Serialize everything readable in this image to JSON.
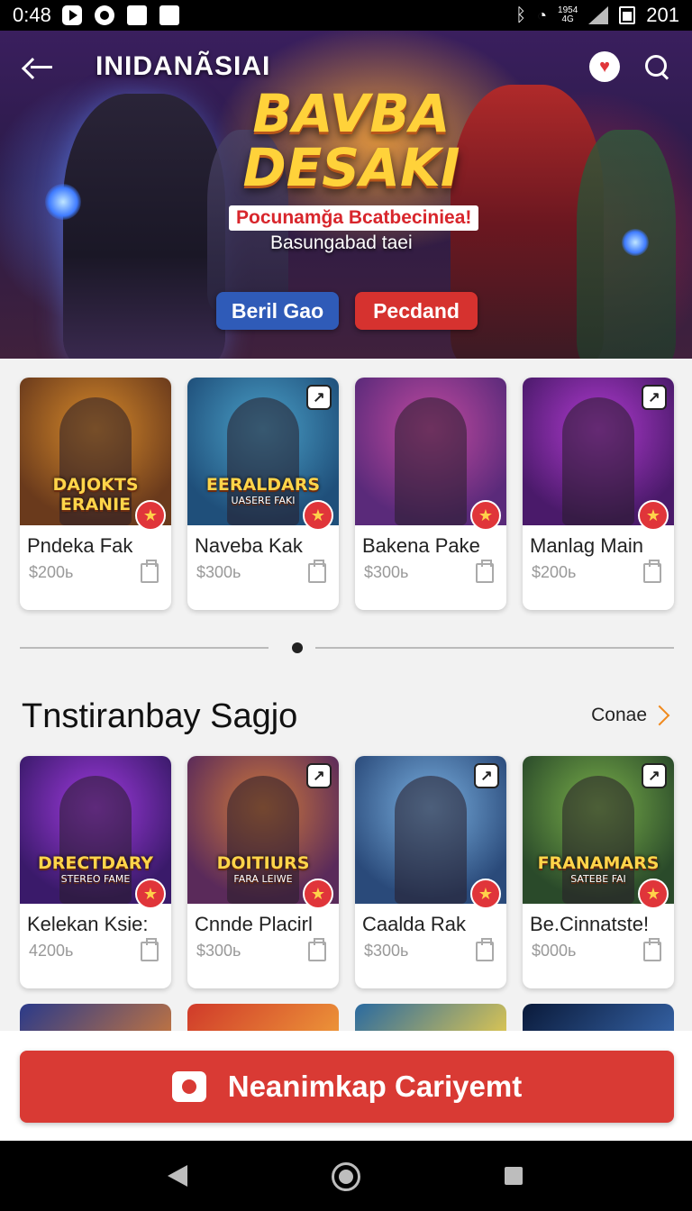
{
  "status_bar": {
    "time": "0:48",
    "signal_text_top": "1954",
    "signal_text_bottom": "4G",
    "battery": "201"
  },
  "header": {
    "title": "INIDANÃSIAI"
  },
  "hero": {
    "title_line1": "BAVBA",
    "title_line2": "DESAKI",
    "subtitle": "Pocunamğa Bcatbeciniea!",
    "subtitle2": "Basungabad taei",
    "button_primary": "Beril Gao",
    "button_secondary": "Pecdand"
  },
  "row1": [
    {
      "title": "Pndeka Fak",
      "price": "$200ь",
      "caption": "DAJOKTS ERANIE",
      "caption_small": "",
      "theme": [
        "#6a3a1c",
        "#d78a2a"
      ],
      "has_expand": false
    },
    {
      "title": "Naveba Kak",
      "price": "$300ь",
      "caption": "EERALDARS",
      "caption_small": "UASERE FAKI",
      "theme": [
        "#1f4f7a",
        "#4aa0c8"
      ],
      "has_expand": true
    },
    {
      "title": "Bakena Pake",
      "price": "$300ь",
      "caption": "",
      "caption_small": "",
      "theme": [
        "#5a2a7a",
        "#c24aa0"
      ],
      "has_expand": false
    },
    {
      "title": "Manlag Main",
      "price": "$200ь",
      "caption": "",
      "caption_small": "",
      "theme": [
        "#4a1a6a",
        "#b03ad0"
      ],
      "has_expand": true
    }
  ],
  "section": {
    "title": "Tnstiranbay Sagjo",
    "link": "Conae"
  },
  "row2": [
    {
      "title": "Kelekan Ksie:",
      "price": "4200ь",
      "caption": "DRECTDARY",
      "caption_small": "STEREO FAME",
      "theme": [
        "#3a1a6a",
        "#a03ae0"
      ],
      "has_expand": false
    },
    {
      "title": "Cnnde Placirl",
      "price": "$300ь",
      "caption": "DOITIURS",
      "caption_small": "FARA LEIWE",
      "theme": [
        "#5a2a5a",
        "#d07a3a"
      ],
      "has_expand": true
    },
    {
      "title": "Caalda Rak",
      "price": "$300ь",
      "caption": "",
      "caption_small": "",
      "theme": [
        "#2a4a7a",
        "#7ab0e0"
      ],
      "has_expand": true
    },
    {
      "title": "Be.Cinnatste!",
      "price": "$000ь",
      "caption": "FRANAMARS",
      "caption_small": "SATEBE FAI",
      "theme": [
        "#2a4a2a",
        "#7ab04a"
      ],
      "has_expand": true
    }
  ],
  "row3_peek": [
    {
      "theme": [
        "#2a3a8a",
        "#d07a3a"
      ]
    },
    {
      "theme": [
        "#d03a2a",
        "#f0a03a"
      ]
    },
    {
      "theme": [
        "#2a6aa0",
        "#f0d04a"
      ]
    },
    {
      "theme": [
        "#0a1a3a",
        "#3a6ab0"
      ]
    }
  ],
  "cta": {
    "label": "Neanimkap Cariyemt"
  },
  "colors": {
    "accent_red": "#d93a34",
    "accent_blue": "#2f5bb8",
    "title_gold": "#ffd23a"
  }
}
